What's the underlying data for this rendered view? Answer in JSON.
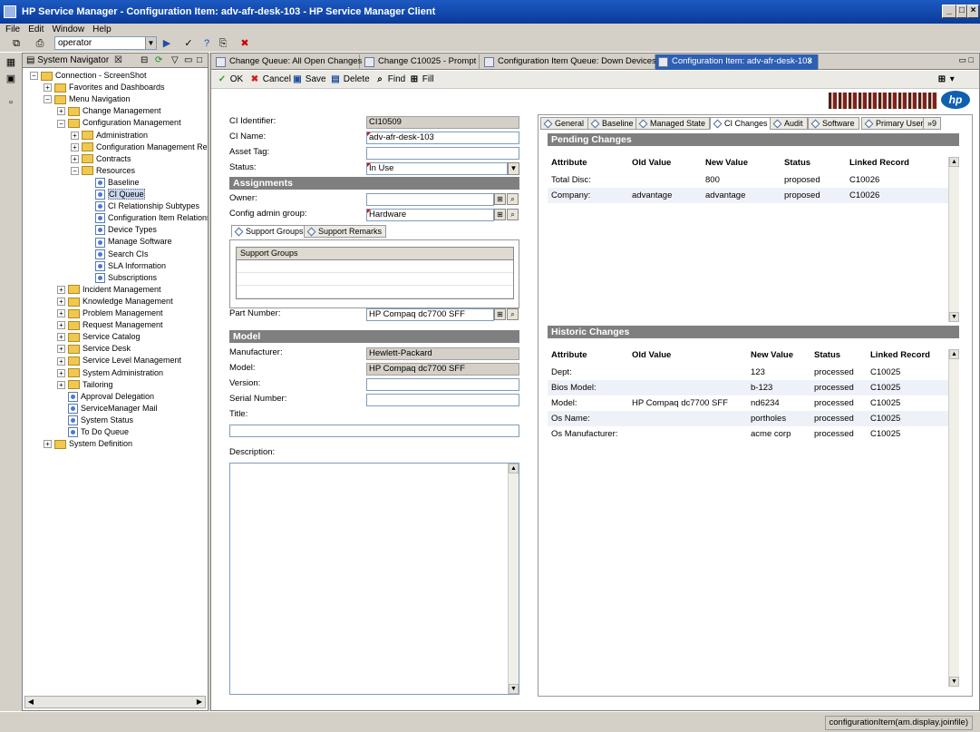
{
  "window": {
    "title": "HP Service Manager - Configuration Item: adv-afr-desk-103 - HP Service Manager Client"
  },
  "menu": [
    "File",
    "Edit",
    "Window",
    "Help"
  ],
  "toolbar": {
    "operator": "operator"
  },
  "navigator": {
    "title": "System Navigator",
    "items": [
      {
        "label": "Connection - ScreenShot",
        "level": 0,
        "kind": "folder",
        "exp": "−"
      },
      {
        "label": "Favorites and Dashboards",
        "level": 1,
        "kind": "folder",
        "exp": "+"
      },
      {
        "label": "Menu Navigation",
        "level": 1,
        "kind": "folder",
        "exp": "−"
      },
      {
        "label": "Change Management",
        "level": 2,
        "kind": "folder",
        "exp": "+"
      },
      {
        "label": "Configuration Management",
        "level": 2,
        "kind": "folder",
        "exp": "−"
      },
      {
        "label": "Administration",
        "level": 3,
        "kind": "folder",
        "exp": "+"
      },
      {
        "label": "Configuration Management Repor",
        "level": 3,
        "kind": "folder",
        "exp": "+"
      },
      {
        "label": "Contracts",
        "level": 3,
        "kind": "folder",
        "exp": "+"
      },
      {
        "label": "Resources",
        "level": 3,
        "kind": "folder",
        "exp": "−"
      },
      {
        "label": "Baseline",
        "level": 4,
        "kind": "leaf"
      },
      {
        "label": "CI Queue",
        "level": 4,
        "kind": "leaf",
        "selected": true
      },
      {
        "label": "CI Relationship Subtypes",
        "level": 4,
        "kind": "leaf"
      },
      {
        "label": "Configuration Item Relationsh",
        "level": 4,
        "kind": "leaf"
      },
      {
        "label": "Device Types",
        "level": 4,
        "kind": "leaf"
      },
      {
        "label": "Manage Software",
        "level": 4,
        "kind": "leaf"
      },
      {
        "label": "Search CIs",
        "level": 4,
        "kind": "leaf"
      },
      {
        "label": "SLA Information",
        "level": 4,
        "kind": "leaf"
      },
      {
        "label": "Subscriptions",
        "level": 4,
        "kind": "leaf"
      },
      {
        "label": "Incident Management",
        "level": 2,
        "kind": "folder",
        "exp": "+"
      },
      {
        "label": "Knowledge Management",
        "level": 2,
        "kind": "folder",
        "exp": "+"
      },
      {
        "label": "Problem Management",
        "level": 2,
        "kind": "folder",
        "exp": "+"
      },
      {
        "label": "Request Management",
        "level": 2,
        "kind": "folder",
        "exp": "+"
      },
      {
        "label": "Service Catalog",
        "level": 2,
        "kind": "folder",
        "exp": "+"
      },
      {
        "label": "Service Desk",
        "level": 2,
        "kind": "folder",
        "exp": "+"
      },
      {
        "label": "Service Level Management",
        "level": 2,
        "kind": "folder",
        "exp": "+"
      },
      {
        "label": "System Administration",
        "level": 2,
        "kind": "folder",
        "exp": "+"
      },
      {
        "label": "Tailoring",
        "level": 2,
        "kind": "folder",
        "exp": "+"
      },
      {
        "label": "Approval Delegation",
        "level": 2,
        "kind": "leaf"
      },
      {
        "label": "ServiceManager Mail",
        "level": 2,
        "kind": "leaf"
      },
      {
        "label": "System Status",
        "level": 2,
        "kind": "leaf"
      },
      {
        "label": "To Do Queue",
        "level": 2,
        "kind": "leaf"
      },
      {
        "label": "System Definition",
        "level": 1,
        "kind": "folder",
        "exp": "+"
      }
    ]
  },
  "tabs": [
    "Change Queue: All Open Changes",
    "Change C10025 - Prompt",
    "Configuration Item Queue: Down Devices",
    "Configuration Item: adv-afr-desk-103"
  ],
  "actions": {
    "ok": "OK",
    "cancel": "Cancel",
    "save": "Save",
    "delete": "Delete",
    "find": "Find",
    "fill": "Fill"
  },
  "form": {
    "ci_identifier_label": "CI Identifier:",
    "ci_identifier": "CI10509",
    "ci_name_label": "CI Name:",
    "ci_name": "adv-afr-desk-103",
    "asset_tag_label": "Asset Tag:",
    "asset_tag": "",
    "status_label": "Status:",
    "status": "In Use",
    "assignments_header": "Assignments",
    "owner_label": "Owner:",
    "owner": "",
    "config_admin_label": "Config admin group:",
    "config_admin": "Hardware",
    "support_tabs": [
      "Support Groups",
      "Support Remarks"
    ],
    "support_groups_header": "Support Groups",
    "part_number_label": "Part Number:",
    "part_number": "HP Compaq dc7700 SFF",
    "model_header": "Model",
    "manufacturer_label": "Manufacturer:",
    "manufacturer": "Hewlett-Packard",
    "model_label": "Model:",
    "model": "HP Compaq dc7700 SFF",
    "version_label": "Version:",
    "version": "",
    "serial_label": "Serial Number:",
    "serial": "",
    "title_label": "Title:",
    "title": "",
    "description_label": "Description:"
  },
  "right_tabs": [
    "General",
    "Baseline",
    "Managed State",
    "CI Changes",
    "Audit",
    "Software",
    "Primary User",
    "»9"
  ],
  "pending": {
    "header": "Pending Changes",
    "columns": [
      "Attribute",
      "Old Value",
      "New Value",
      "Status",
      "Linked Record"
    ],
    "rows": [
      [
        "Total Disc:",
        "",
        "800",
        "proposed",
        "C10026"
      ],
      [
        "Company:",
        "advantage",
        "advantage",
        "proposed",
        "C10026"
      ]
    ]
  },
  "historic": {
    "header": "Historic Changes",
    "columns": [
      "Attribute",
      "Old Value",
      "New Value",
      "Status",
      "Linked Record"
    ],
    "rows": [
      [
        "Dept:",
        "",
        "123",
        "processed",
        "C10025"
      ],
      [
        "Bios Model:",
        "",
        "b-123",
        "processed",
        "C10025"
      ],
      [
        "Model:",
        "HP Compaq dc7700 SFF",
        "nd6234",
        "processed",
        "C10025"
      ],
      [
        "Os Name:",
        "",
        "portholes",
        "processed",
        "C10025"
      ],
      [
        "Os Manufacturer:",
        "",
        "acme corp",
        "processed",
        "C10025"
      ]
    ]
  },
  "status_bar": "configurationItem(am.display.joinfile)"
}
